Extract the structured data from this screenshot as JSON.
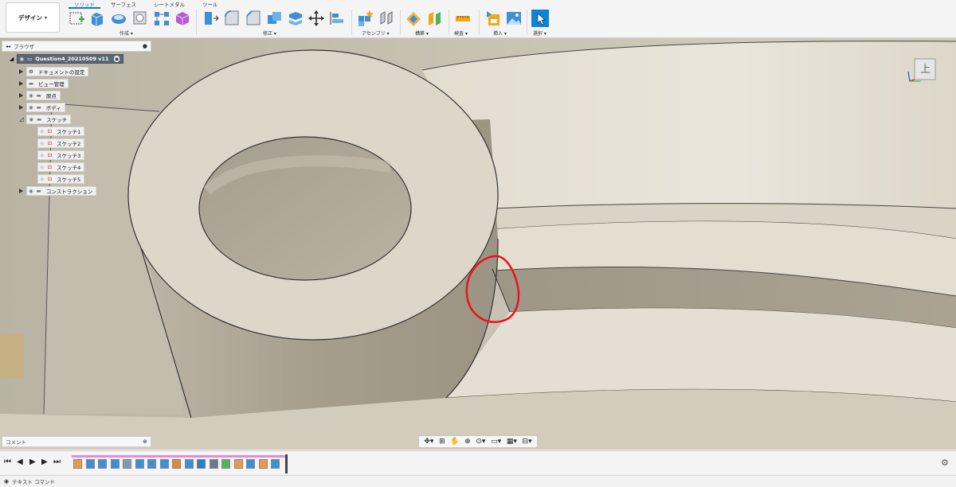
{
  "toolbar": {
    "design_label": "デザイン",
    "tabs": [
      "ソリッド",
      "サーフェス",
      "シートメタル",
      "ツール"
    ],
    "groups": [
      "作成",
      "修正",
      "アセンブリ",
      "構築",
      "検査",
      "挿入",
      "選択"
    ]
  },
  "browser": {
    "title": "ブラウザ",
    "root": "Question4_20210509 v11",
    "items": [
      "ドキュメントの設定",
      "ビュー管理",
      "原点",
      "ボディ",
      "スケッチ"
    ],
    "sketches": [
      "スケッチ1",
      "スケッチ2",
      "スケッチ3",
      "スケッチ4",
      "スケッチ5"
    ],
    "construction": "コンストラクション"
  },
  "viewcube": {
    "face_label": "上"
  },
  "comments": {
    "label": "コメント"
  },
  "text_command": {
    "label": "テキスト コマンド"
  },
  "annotation": {
    "color": "#e8141b"
  },
  "colors": {
    "accent": "#1a73c9",
    "select_bg": "#0b84d9",
    "timeline_bar": "#e889e0"
  },
  "timeline_feature_count": 17
}
